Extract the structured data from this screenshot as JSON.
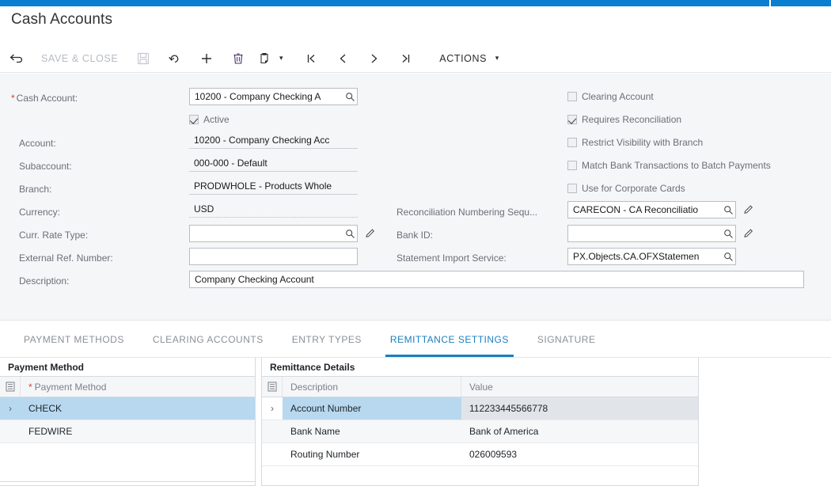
{
  "window": {
    "title": "Cash Accounts",
    "accent_color": "#0a7ed0",
    "tab_active_color": "#1a7fc1",
    "row_select_color": "#b7d8ef"
  },
  "toolbar": {
    "back_icon": "back-arrow-icon",
    "save_close_label": "SAVE & CLOSE",
    "save_icon": "save-disk-icon",
    "undo_icon": "undo-arrow-icon",
    "add_icon": "plus-icon",
    "delete_icon": "trash-icon",
    "copy_paste_icon": "clipboard-icon",
    "copy_paste_caret": "▾",
    "first_icon": "first-record-icon",
    "prev_icon": "previous-record-icon",
    "next_icon": "next-record-icon",
    "last_icon": "last-record-icon",
    "actions_label": "ACTIONS",
    "actions_caret": "▾"
  },
  "form": {
    "left_fields": [
      {
        "label": "Cash Account:",
        "required": true,
        "value": "10200 - Company Checking A",
        "style": "boxed",
        "selector_icon": "magnifier-icon"
      },
      {
        "label": "Account:",
        "required": false,
        "value": "10200 - Company Checking Acc",
        "style": "readonly"
      },
      {
        "label": "Subaccount:",
        "required": false,
        "value": "000-000 - Default",
        "style": "readonly"
      },
      {
        "label": "Branch:",
        "required": false,
        "value": "PRODWHOLE - Products Whole",
        "style": "readonly"
      },
      {
        "label": "Currency:",
        "required": false,
        "value": "USD",
        "style": "readonly-dotted"
      },
      {
        "label": "Curr. Rate Type:",
        "required": false,
        "value": "",
        "style": "boxed",
        "selector_icon": "magnifier-icon",
        "edit_icon": "pencil-icon"
      },
      {
        "label": "External Ref. Number:",
        "required": false,
        "value": "",
        "style": "boxed"
      },
      {
        "label": "Description:",
        "required": false,
        "value": "Company Checking Account",
        "style": "boxed-wide"
      }
    ],
    "active_checkbox": {
      "label": "Active",
      "checked": true
    },
    "right_checkboxes": [
      {
        "label": "Clearing Account",
        "checked": false
      },
      {
        "label": "Requires Reconciliation",
        "checked": true
      },
      {
        "label": "Restrict Visibility with Branch",
        "checked": false
      },
      {
        "label": "Match Bank Transactions to Batch Payments",
        "checked": false
      },
      {
        "label": "Use for Corporate Cards",
        "checked": false
      }
    ],
    "right_fields": [
      {
        "label": "Reconciliation Numbering Sequ...",
        "value": "CARECON - CA Reconciliatio",
        "selector_icon": "magnifier-icon",
        "edit_icon": "pencil-icon"
      },
      {
        "label": "Bank ID:",
        "value": "",
        "selector_icon": "magnifier-icon",
        "edit_icon": "pencil-icon"
      },
      {
        "label": "Statement Import Service:",
        "value": "PX.Objects.CA.OFXStatemen",
        "selector_icon": "magnifier-icon"
      }
    ]
  },
  "tabs": [
    {
      "label": "PAYMENT METHODS",
      "active": false
    },
    {
      "label": "CLEARING ACCOUNTS",
      "active": false
    },
    {
      "label": "ENTRY TYPES",
      "active": false
    },
    {
      "label": "REMITTANCE SETTINGS",
      "active": true
    },
    {
      "label": "SIGNATURE",
      "active": false
    }
  ],
  "payment_method_grid": {
    "caption": "Payment Method",
    "selector_icon": "grid-settings-icon",
    "columns": [
      {
        "label": "Payment Method",
        "required": true
      }
    ],
    "rows": [
      {
        "indicator": "›",
        "payment_method": "CHECK",
        "selected": true
      },
      {
        "indicator": "",
        "payment_method": "FEDWIRE",
        "selected": false
      }
    ]
  },
  "remittance_grid": {
    "caption": "Remittance Details",
    "selector_icon": "grid-settings-icon",
    "columns": [
      {
        "label": "Description"
      },
      {
        "label": "Value"
      }
    ],
    "rows": [
      {
        "indicator": "›",
        "description": "Account Number",
        "value": "112233445566778",
        "selected": true
      },
      {
        "indicator": "",
        "description": "Bank Name",
        "value": "Bank of America",
        "selected": false
      },
      {
        "indicator": "",
        "description": "Routing Number",
        "value": "026009593",
        "selected": false
      }
    ]
  }
}
